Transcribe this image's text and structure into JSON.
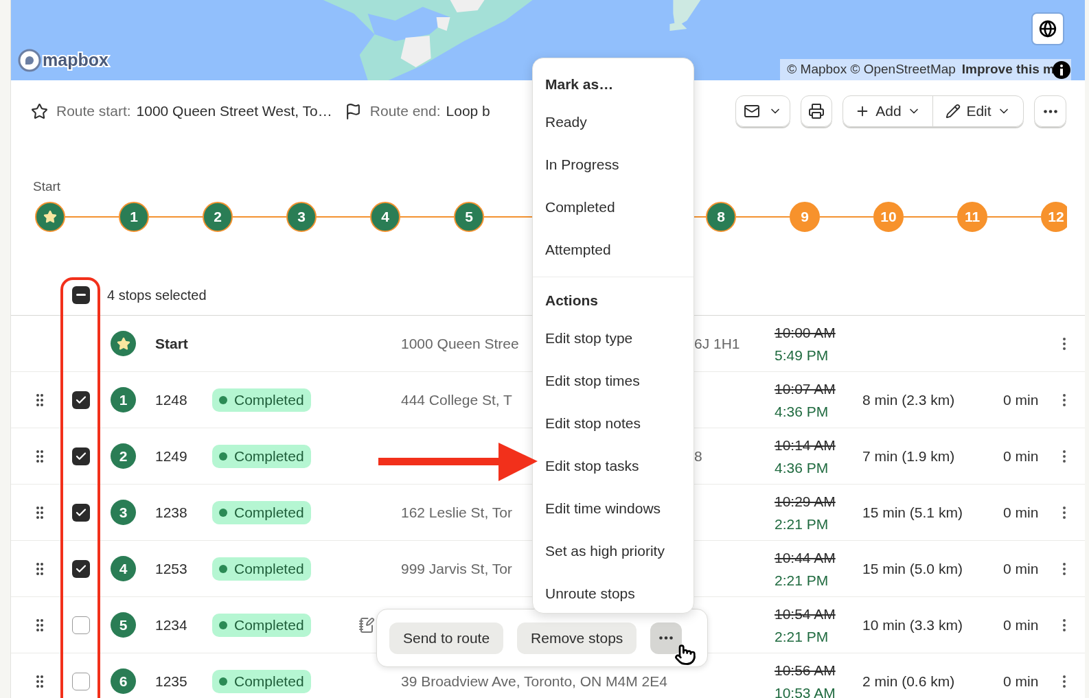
{
  "map": {
    "logo": "mapbox",
    "attribution": "© Mapbox © OpenStreetMap",
    "improve_link": "Improve this m"
  },
  "route": {
    "start_label": "Route start:",
    "start_value": "1000 Queen Street West, To…",
    "end_label": "Route end:",
    "end_value": "Loop b"
  },
  "toolbar": {
    "add": "Add",
    "edit": "Edit"
  },
  "timeline": {
    "start_label": "Start",
    "left": [
      {
        "kind": "start",
        "completed": true
      },
      {
        "kind": "stop",
        "label": "1",
        "completed": true
      },
      {
        "kind": "stop",
        "label": "2",
        "completed": true
      },
      {
        "kind": "stop",
        "label": "3",
        "completed": true
      },
      {
        "kind": "stop",
        "label": "4",
        "completed": true
      },
      {
        "kind": "stop",
        "label": "5",
        "completed": true
      }
    ],
    "right": [
      {
        "label": "8",
        "completed": true
      },
      {
        "label": "9",
        "completed": false
      },
      {
        "label": "10",
        "completed": false
      },
      {
        "label": "11",
        "completed": false
      },
      {
        "label": "12",
        "completed": false
      }
    ]
  },
  "selection": {
    "indeterminate": true,
    "text": "4 stops selected"
  },
  "rows": [
    {
      "kind": "start",
      "name": "Start",
      "address": "1000 Queen Stree",
      "address_tail": "6J 1H1",
      "planned": "10:00 AM",
      "actual": "5:49 PM"
    },
    {
      "kind": "stop",
      "number": "1",
      "id": "1248",
      "status": "Completed",
      "checked": true,
      "note": false,
      "address": "444 College St, T",
      "planned": "10:07 AM",
      "actual": "4:36 PM",
      "drive": "8 min (2.3 km)",
      "wait": "0 min"
    },
    {
      "kind": "stop",
      "number": "2",
      "id": "1249",
      "status": "Completed",
      "checked": true,
      "note": false,
      "address_tail": "8",
      "planned": "10:14 AM",
      "actual": "4:36 PM",
      "drive": "7 min (1.9 km)",
      "wait": "0 min"
    },
    {
      "kind": "stop",
      "number": "3",
      "id": "1238",
      "status": "Completed",
      "checked": true,
      "note": false,
      "address": "162 Leslie St, Tor",
      "planned": "10:29 AM",
      "actual": "2:21 PM",
      "drive": "15 min (5.1 km)",
      "wait": "0 min"
    },
    {
      "kind": "stop",
      "number": "4",
      "id": "1253",
      "status": "Completed",
      "checked": true,
      "note": false,
      "address": "999 Jarvis St, Tor",
      "planned": "10:44 AM",
      "actual": "2:21 PM",
      "drive": "15 min (5.0 km)",
      "wait": "0 min"
    },
    {
      "kind": "stop",
      "number": "5",
      "id": "1234",
      "status": "Completed",
      "checked": false,
      "note": true,
      "planned": "10:54 AM",
      "actual": "2:21 PM",
      "drive": "10 min (3.3 km)",
      "wait": "0 min"
    },
    {
      "kind": "stop",
      "number": "6",
      "id": "1235",
      "status": "Completed",
      "checked": false,
      "note": false,
      "address": "39 Broadview Ave, Toronto, ON M4M 2E4",
      "planned": "10:56 AM",
      "actual": "10:53 AM",
      "drive": "2 min (0.6 km)",
      "wait": "0 min"
    }
  ],
  "menu": {
    "sections": [
      {
        "title": "Mark as…",
        "items": [
          "Ready",
          "In Progress",
          "Completed",
          "Attempted"
        ]
      },
      {
        "title": "Actions",
        "items": [
          "Edit stop type",
          "Edit stop times",
          "Edit stop notes",
          "Edit stop tasks",
          "Edit time windows",
          "Set as high priority",
          "Unroute stops"
        ]
      }
    ]
  },
  "action_bar": {
    "buttons": [
      "Send to route",
      "Remove stops"
    ],
    "more_hovered": true
  }
}
